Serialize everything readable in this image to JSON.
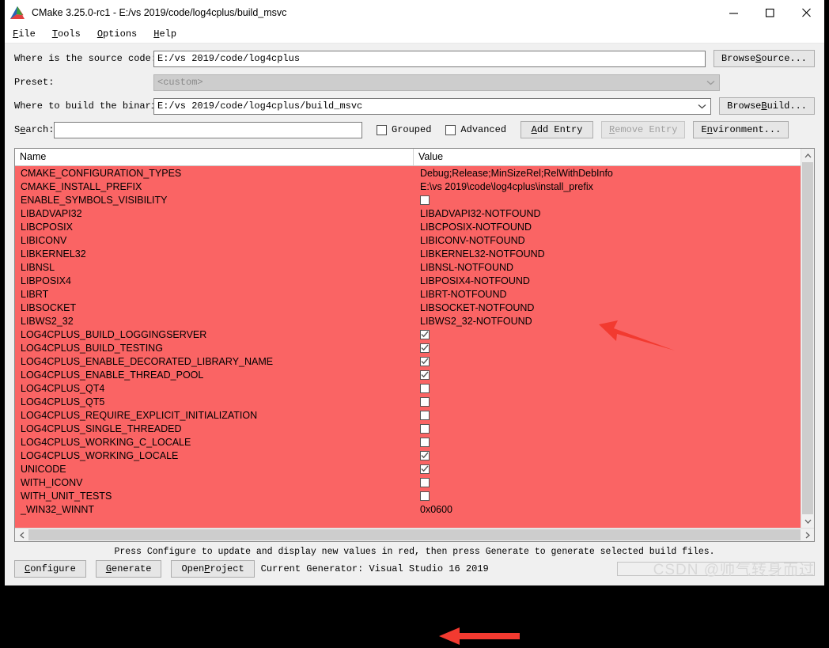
{
  "window": {
    "title": "CMake 3.25.0-rc1 - E:/vs 2019/code/log4cplus/build_msvc",
    "app_icon": "cmake-logo-icon",
    "minimize": "minimize-icon",
    "maximize": "maximize-icon",
    "close": "close-icon"
  },
  "menu": [
    {
      "label": "File",
      "accel": "F"
    },
    {
      "label": "Tools",
      "accel": "T"
    },
    {
      "label": "Options",
      "accel": "O"
    },
    {
      "label": "Help",
      "accel": "H"
    }
  ],
  "form": {
    "source_label": "Where is the source code:",
    "source_value": "E:/vs 2019/code/log4cplus",
    "browse_source_label": "Browse Source...",
    "browse_source_accel": "S",
    "preset_label": "Preset:",
    "preset_value": "<custom>",
    "build_label": "Where to build the binaries:",
    "build_value": "E:/vs 2019/code/log4cplus/build_msvc",
    "browse_build_label": "Browse Build...",
    "browse_build_accel": "B",
    "search_label": "Search:",
    "search_value": "",
    "grouped_label": "Grouped",
    "grouped_checked": false,
    "advanced_label": "Advanced",
    "advanced_checked": false,
    "add_entry_label": "Add Entry",
    "add_entry_accel": "A",
    "remove_entry_label": "Remove Entry",
    "remove_entry_accel": "R",
    "remove_entry_disabled": true,
    "environment_label": "Environment...",
    "environment_accel": "n"
  },
  "table": {
    "columns": [
      "Name",
      "Value"
    ],
    "rows": [
      {
        "name": "CMAKE_CONFIGURATION_TYPES",
        "type": "text",
        "value": "Debug;Release;MinSizeRel;RelWithDebInfo"
      },
      {
        "name": "CMAKE_INSTALL_PREFIX",
        "type": "text",
        "value": "E:\\vs 2019\\code\\log4cplus\\install_prefix"
      },
      {
        "name": "ENABLE_SYMBOLS_VISIBILITY",
        "type": "bool",
        "checked": false
      },
      {
        "name": "LIBADVAPI32",
        "type": "text",
        "value": "LIBADVAPI32-NOTFOUND"
      },
      {
        "name": "LIBCPOSIX",
        "type": "text",
        "value": "LIBCPOSIX-NOTFOUND"
      },
      {
        "name": "LIBICONV",
        "type": "text",
        "value": "LIBICONV-NOTFOUND"
      },
      {
        "name": "LIBKERNEL32",
        "type": "text",
        "value": "LIBKERNEL32-NOTFOUND"
      },
      {
        "name": "LIBNSL",
        "type": "text",
        "value": "LIBNSL-NOTFOUND"
      },
      {
        "name": "LIBPOSIX4",
        "type": "text",
        "value": "LIBPOSIX4-NOTFOUND"
      },
      {
        "name": "LIBRT",
        "type": "text",
        "value": "LIBRT-NOTFOUND"
      },
      {
        "name": "LIBSOCKET",
        "type": "text",
        "value": "LIBSOCKET-NOTFOUND"
      },
      {
        "name": "LIBWS2_32",
        "type": "text",
        "value": "LIBWS2_32-NOTFOUND"
      },
      {
        "name": "LOG4CPLUS_BUILD_LOGGINGSERVER",
        "type": "bool",
        "checked": true
      },
      {
        "name": "LOG4CPLUS_BUILD_TESTING",
        "type": "bool",
        "checked": true
      },
      {
        "name": "LOG4CPLUS_ENABLE_DECORATED_LIBRARY_NAME",
        "type": "bool",
        "checked": true
      },
      {
        "name": "LOG4CPLUS_ENABLE_THREAD_POOL",
        "type": "bool",
        "checked": true
      },
      {
        "name": "LOG4CPLUS_QT4",
        "type": "bool",
        "checked": false
      },
      {
        "name": "LOG4CPLUS_QT5",
        "type": "bool",
        "checked": false
      },
      {
        "name": "LOG4CPLUS_REQUIRE_EXPLICIT_INITIALIZATION",
        "type": "bool",
        "checked": false
      },
      {
        "name": "LOG4CPLUS_SINGLE_THREADED",
        "type": "bool",
        "checked": false
      },
      {
        "name": "LOG4CPLUS_WORKING_C_LOCALE",
        "type": "bool",
        "checked": false
      },
      {
        "name": "LOG4CPLUS_WORKING_LOCALE",
        "type": "bool",
        "checked": true
      },
      {
        "name": "UNICODE",
        "type": "bool",
        "checked": true
      },
      {
        "name": "WITH_ICONV",
        "type": "bool",
        "checked": false
      },
      {
        "name": "WITH_UNIT_TESTS",
        "type": "bool",
        "checked": false
      },
      {
        "name": "_WIN32_WINNT",
        "type": "text",
        "value": "0x0600"
      }
    ]
  },
  "footer": {
    "status": "Press Configure to update and display new values in red, then press Generate to generate selected build files.",
    "configure_label": "Configure",
    "configure_accel": "C",
    "generate_label": "Generate",
    "generate_accel": "G",
    "open_project_label": "Open Project",
    "open_project_accel": "P",
    "generator_text": "Current Generator: Visual Studio 16 2019"
  },
  "annotations": {
    "watermark": "CSDN @帅气转身而过",
    "arrow_color": "#f23a30",
    "arrows": [
      {
        "name": "arrow-install-prefix"
      },
      {
        "name": "arrow-with-unit-tests"
      }
    ]
  },
  "colors": {
    "modified_row_red": "#fa6464",
    "window_bg": "#f0f0f0"
  }
}
